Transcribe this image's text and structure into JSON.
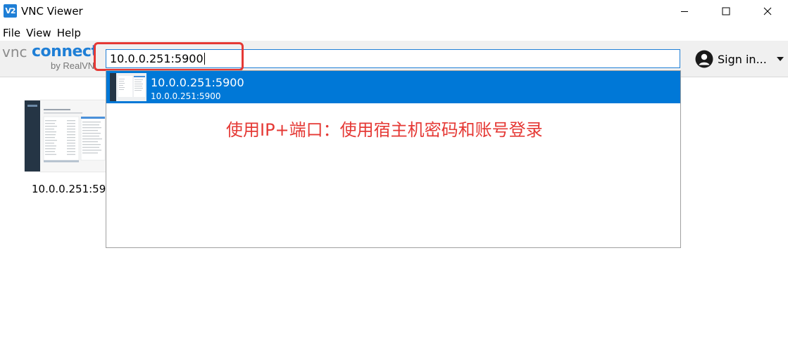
{
  "window": {
    "title": "VNC Viewer",
    "app_icon_text": "V2",
    "controls": [
      "minimize-icon",
      "maximize-icon",
      "close-icon"
    ]
  },
  "menu": {
    "items": [
      {
        "label": "File"
      },
      {
        "label": "View"
      },
      {
        "label": "Help"
      }
    ]
  },
  "toolbar": {
    "logo": {
      "vnc": "vnc",
      "connect": "connect",
      "by": "by RealVNC"
    },
    "address": {
      "value": "10.0.0.251:5900"
    },
    "signin": {
      "label": "Sign in...",
      "icon": "user-avatar-icon",
      "dropdown_icon": "chevron-down-icon"
    }
  },
  "address_book": {
    "items": [
      {
        "caption": "10.0.0.251:5900"
      }
    ]
  },
  "suggestions": {
    "items": [
      {
        "title": "10.0.0.251:5900",
        "subtitle": "10.0.0.251:5900"
      }
    ]
  },
  "annotation": {
    "text": "使用IP+端口：使用宿主机密码和账号登录",
    "color": "#e53935"
  },
  "colors": {
    "accent": "#0078d7",
    "highlight": "#e53935"
  }
}
